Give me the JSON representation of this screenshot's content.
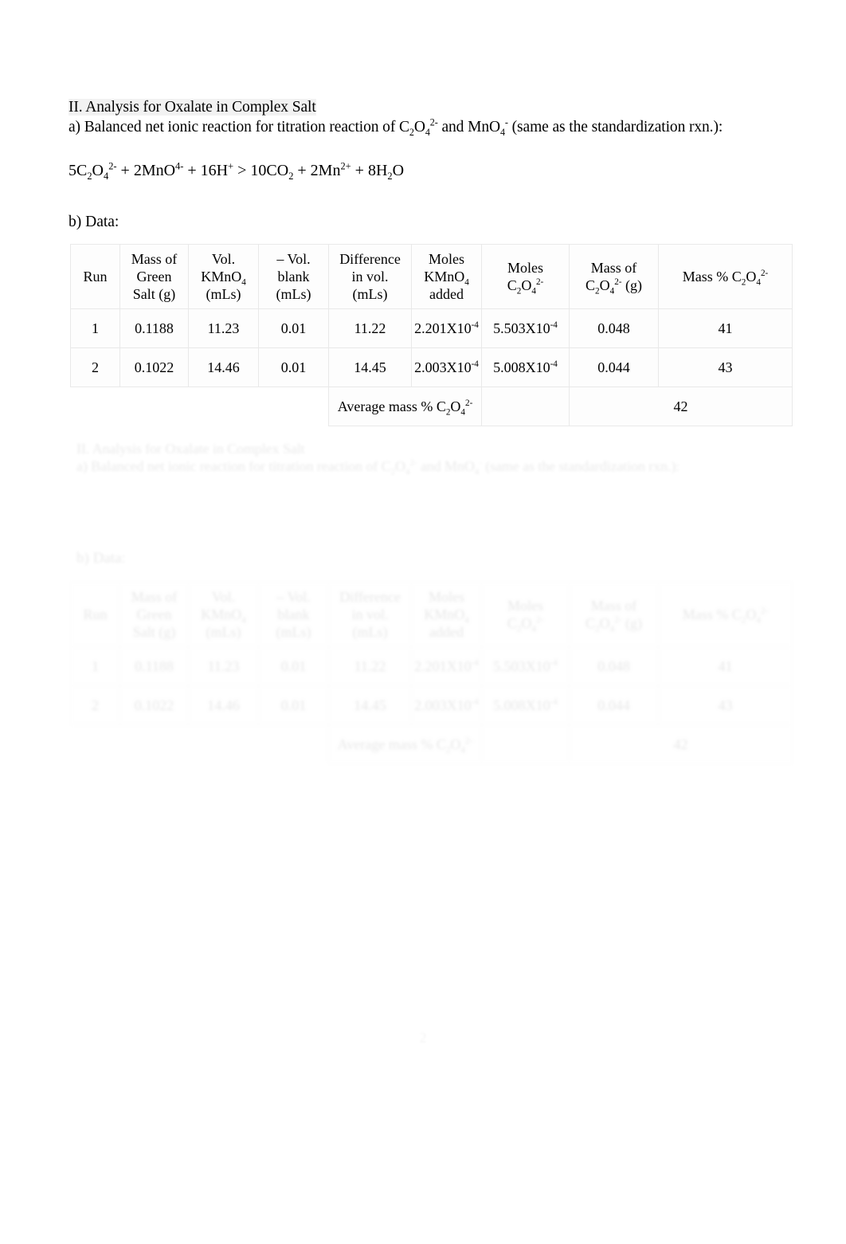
{
  "document": {
    "section_heading": "II. Analysis for Oxalate in Complex Salt",
    "part_a_label": "a) Balanced net ionic reaction for titration reaction of C",
    "part_a_text_full": "a) Balanced net ionic reaction for titration reaction of C2O4(2-) and MnO4(-) (same as the standardization rxn.):",
    "part_a_mid": "and MnO",
    "part_a_tail": "(same as the standardization rxn.):",
    "equation": "5C2O4(2-) + 2MnO(4-) + 16H(+) > 10CO2 + 2Mn(2+) + 8H2O",
    "data_label": "b) Data:",
    "page_number": "2"
  },
  "equation_parts": {
    "coef1": "5C",
    "sub1": "2",
    "elem1": "O",
    "sub2": "4",
    "charge1": "2-",
    "plus1": " + ",
    "coef2": "2MnO",
    "charge2": "4-",
    "plus2": " + ",
    "coef3": "16H",
    "charge3": "+",
    "arrow": " > ",
    "coef4": "10CO",
    "sub4": "2",
    "plus3": " + ",
    "coef5": "2Mn",
    "charge5": "2+",
    "plus4": " + ",
    "coef6": "8H",
    "sub6": "2",
    "elem6": "O"
  },
  "table": {
    "headers": {
      "run": "Run",
      "mass_green_salt": "Mass of Green Salt (g)",
      "mass_green_salt_l1": "Mass of",
      "mass_green_salt_l2": "Green",
      "mass_green_salt_l3": "Salt (g)",
      "vol_kmno4_l1": "Vol.",
      "vol_kmno4_l2": "KMnO",
      "vol_kmno4_sub": "4",
      "vol_kmno4_l3": "(mLs)",
      "blank_l1": "– Vol.",
      "blank_l2": "blank",
      "blank_l3": "(mLs)",
      "diff_l1": "Difference",
      "diff_l2": "in vol.",
      "diff_l3": "(mLs)",
      "moles_kmno4_l1": "Moles",
      "moles_kmno4_l2": "KMnO",
      "moles_kmno4_sub": "4",
      "moles_kmno4_l3": "added",
      "moles_ox_l1": "Moles",
      "moles_ox_l2": "C",
      "moles_ox_sub1": "2",
      "moles_ox_l3": "O",
      "moles_ox_sub2": "4",
      "moles_ox_charge": "2-",
      "mass_ox_l1": "Mass of",
      "mass_ox_l2": "C",
      "mass_ox_sub1": "2",
      "mass_ox_l3": "O",
      "mass_ox_sub2": "4",
      "mass_ox_charge": "2-",
      "mass_ox_l4": "(g)",
      "masspct_l1": "Mass % C",
      "masspct_sub1": "2",
      "masspct_l2": "O",
      "masspct_sub2": "4",
      "masspct_charge": "2-"
    },
    "rows": [
      {
        "run": "1",
        "mass_green_salt": "0.1188",
        "vol_kmno4": "11.23",
        "vol_blank": "0.01",
        "difference": "11.22",
        "moles_kmno4_mantissa": "2.201X10",
        "moles_kmno4_exp": "-4",
        "moles_oxalate_mantissa": "5.503X10",
        "moles_oxalate_exp": "-4",
        "mass_oxalate": "0.048",
        "mass_percent": "41"
      },
      {
        "run": "2",
        "mass_green_salt": "0.1022",
        "vol_kmno4": "14.46",
        "vol_blank": "0.01",
        "difference": "14.45",
        "moles_kmno4_mantissa": "2.003X10",
        "moles_kmno4_exp": "-4",
        "moles_oxalate_mantissa": "5.008X10",
        "moles_oxalate_exp": "-4",
        "mass_oxalate": "0.044",
        "mass_percent": "43"
      }
    ],
    "average": {
      "label_prefix": "Average mass % C",
      "label_sub1": "2",
      "label_mid": "O",
      "label_sub2": "4",
      "label_charge": "2-",
      "value": "42"
    }
  }
}
